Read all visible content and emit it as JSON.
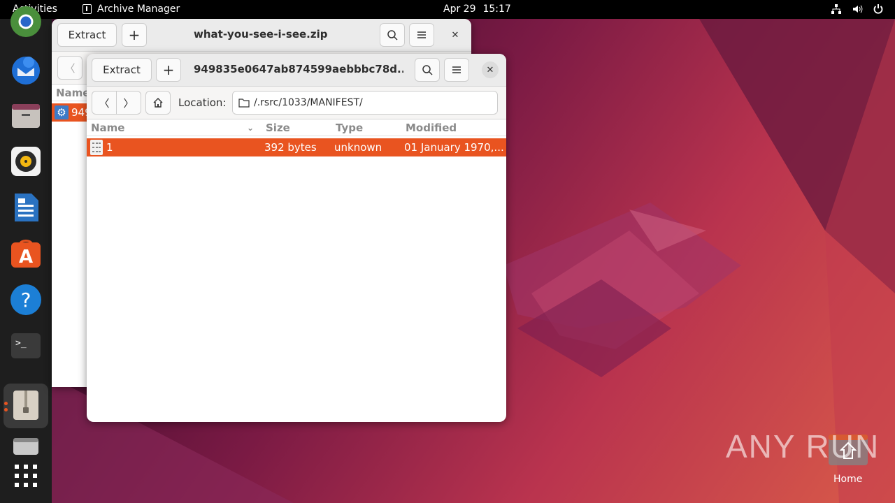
{
  "topbar": {
    "activities": "Activities",
    "app_name": "Archive Manager",
    "date": "Apr 29",
    "time": "15:17"
  },
  "dock": {
    "items": [
      "chrome-icon",
      "thunderbird-icon",
      "files-icon",
      "rhythmbox-icon",
      "libreoffice-writer-icon",
      "app-center-icon",
      "help-icon",
      "terminal-icon",
      "archive-manager-icon",
      "drive-icon",
      "show-apps-icon"
    ]
  },
  "back_window": {
    "extract_label": "Extract",
    "title": "what-you-see-i-see.zip",
    "col_name": "Name",
    "row_name": "949"
  },
  "front_window": {
    "extract_label": "Extract",
    "title": "949835e0647ab874599aebbbc78d...",
    "location_label": "Location:",
    "location_value": "/.rsrc/1033/MANIFEST/",
    "columns": {
      "name": "Name",
      "size": "Size",
      "type": "Type",
      "modified": "Modified"
    },
    "rows": [
      {
        "name": "1",
        "size": "392 bytes",
        "type": "unknown",
        "modified": "01 January 1970,..."
      }
    ]
  },
  "desktop": {
    "watermark": "ANY RUN",
    "home_label": "Home"
  },
  "colors": {
    "accent": "#e95420",
    "topbar": "#000000",
    "dock": "#1e1e1e"
  }
}
